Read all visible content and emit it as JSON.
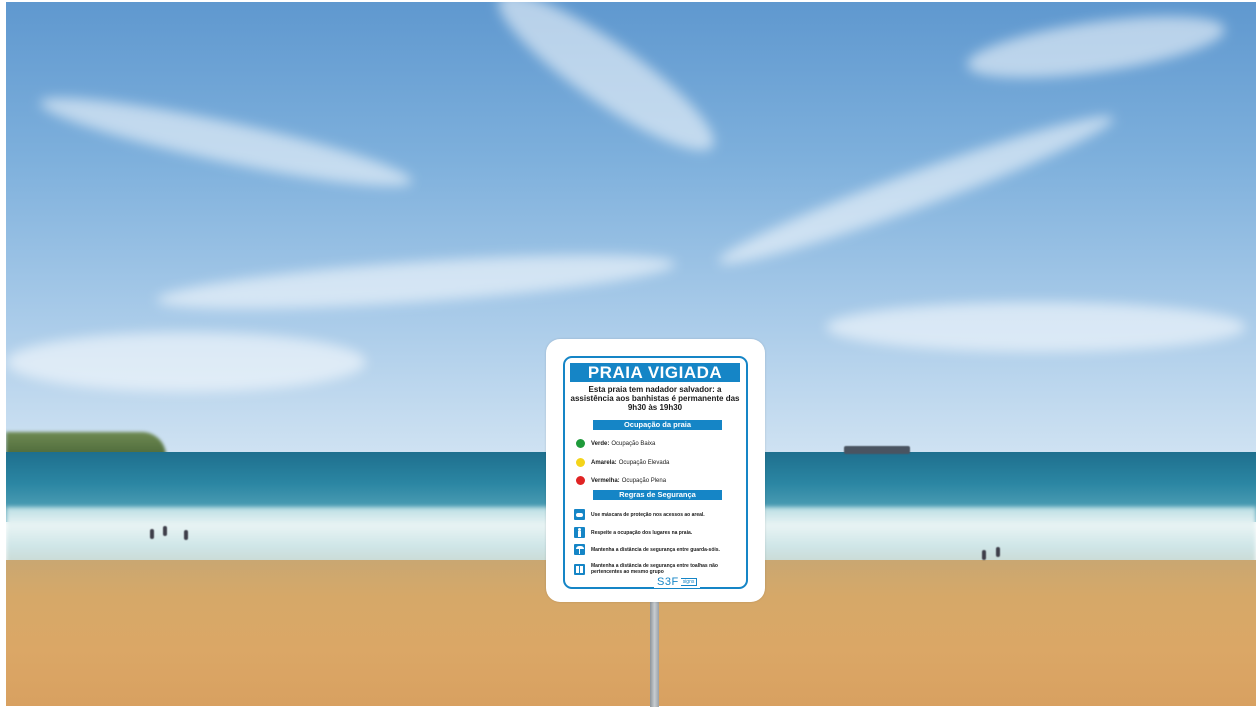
{
  "sign": {
    "title": "PRAIA VIGIADA",
    "intro": "Esta praia tem nadador salvador: a assistência aos banhistas é permanente das 9h30 às 19h30",
    "occupancy_heading": "Ocupação da praia",
    "occupancy": [
      {
        "color_name": "Verde:",
        "label": "Ocupação Baixa",
        "color": "#1e9a3a"
      },
      {
        "color_name": "Amarela:",
        "label": "Ocupação Elevada",
        "color": "#f4d41a"
      },
      {
        "color_name": "Vermelha:",
        "label": "Ocupação Plena",
        "color": "#e02424"
      }
    ],
    "rules_heading": "Regras de Segurança",
    "rules": [
      {
        "text": "Use máscara de proteção nos acessos ao areal.",
        "icon": "mask-icon"
      },
      {
        "text": "Respeite a ocupação dos lugares na praia.",
        "icon": "person-icon"
      },
      {
        "text": "Mantenha a distância de segurança entre guarda-sóis.",
        "icon": "umbrella-icon"
      },
      {
        "text": "Mantenha a distância de segurança entre toalhas não pertencentes ao mesmo grupo",
        "icon": "towel-icon"
      }
    ],
    "brand_main": "S3F",
    "brand_sub": "signs",
    "accent": "#1585c6"
  }
}
